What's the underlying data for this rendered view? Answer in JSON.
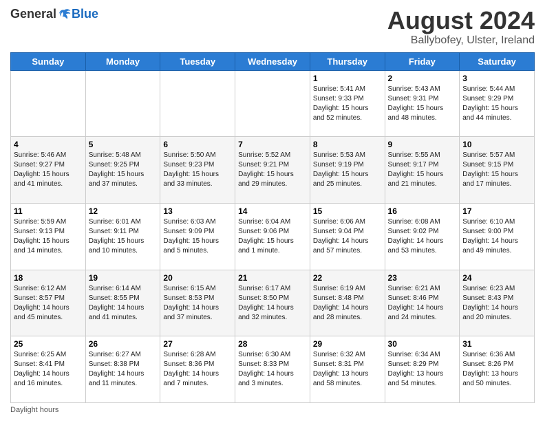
{
  "logo": {
    "general": "General",
    "blue": "Blue"
  },
  "title": {
    "month_year": "August 2024",
    "location": "Ballybofey, Ulster, Ireland"
  },
  "days_of_week": [
    "Sunday",
    "Monday",
    "Tuesday",
    "Wednesday",
    "Thursday",
    "Friday",
    "Saturday"
  ],
  "footer": {
    "daylight_label": "Daylight hours"
  },
  "weeks": [
    [
      {
        "date": "",
        "info": ""
      },
      {
        "date": "",
        "info": ""
      },
      {
        "date": "",
        "info": ""
      },
      {
        "date": "",
        "info": ""
      },
      {
        "date": "1",
        "info": "Sunrise: 5:41 AM\nSunset: 9:33 PM\nDaylight: 15 hours\nand 52 minutes."
      },
      {
        "date": "2",
        "info": "Sunrise: 5:43 AM\nSunset: 9:31 PM\nDaylight: 15 hours\nand 48 minutes."
      },
      {
        "date": "3",
        "info": "Sunrise: 5:44 AM\nSunset: 9:29 PM\nDaylight: 15 hours\nand 44 minutes."
      }
    ],
    [
      {
        "date": "4",
        "info": "Sunrise: 5:46 AM\nSunset: 9:27 PM\nDaylight: 15 hours\nand 41 minutes."
      },
      {
        "date": "5",
        "info": "Sunrise: 5:48 AM\nSunset: 9:25 PM\nDaylight: 15 hours\nand 37 minutes."
      },
      {
        "date": "6",
        "info": "Sunrise: 5:50 AM\nSunset: 9:23 PM\nDaylight: 15 hours\nand 33 minutes."
      },
      {
        "date": "7",
        "info": "Sunrise: 5:52 AM\nSunset: 9:21 PM\nDaylight: 15 hours\nand 29 minutes."
      },
      {
        "date": "8",
        "info": "Sunrise: 5:53 AM\nSunset: 9:19 PM\nDaylight: 15 hours\nand 25 minutes."
      },
      {
        "date": "9",
        "info": "Sunrise: 5:55 AM\nSunset: 9:17 PM\nDaylight: 15 hours\nand 21 minutes."
      },
      {
        "date": "10",
        "info": "Sunrise: 5:57 AM\nSunset: 9:15 PM\nDaylight: 15 hours\nand 17 minutes."
      }
    ],
    [
      {
        "date": "11",
        "info": "Sunrise: 5:59 AM\nSunset: 9:13 PM\nDaylight: 15 hours\nand 14 minutes."
      },
      {
        "date": "12",
        "info": "Sunrise: 6:01 AM\nSunset: 9:11 PM\nDaylight: 15 hours\nand 10 minutes."
      },
      {
        "date": "13",
        "info": "Sunrise: 6:03 AM\nSunset: 9:09 PM\nDaylight: 15 hours\nand 5 minutes."
      },
      {
        "date": "14",
        "info": "Sunrise: 6:04 AM\nSunset: 9:06 PM\nDaylight: 15 hours\nand 1 minute."
      },
      {
        "date": "15",
        "info": "Sunrise: 6:06 AM\nSunset: 9:04 PM\nDaylight: 14 hours\nand 57 minutes."
      },
      {
        "date": "16",
        "info": "Sunrise: 6:08 AM\nSunset: 9:02 PM\nDaylight: 14 hours\nand 53 minutes."
      },
      {
        "date": "17",
        "info": "Sunrise: 6:10 AM\nSunset: 9:00 PM\nDaylight: 14 hours\nand 49 minutes."
      }
    ],
    [
      {
        "date": "18",
        "info": "Sunrise: 6:12 AM\nSunset: 8:57 PM\nDaylight: 14 hours\nand 45 minutes."
      },
      {
        "date": "19",
        "info": "Sunrise: 6:14 AM\nSunset: 8:55 PM\nDaylight: 14 hours\nand 41 minutes."
      },
      {
        "date": "20",
        "info": "Sunrise: 6:15 AM\nSunset: 8:53 PM\nDaylight: 14 hours\nand 37 minutes."
      },
      {
        "date": "21",
        "info": "Sunrise: 6:17 AM\nSunset: 8:50 PM\nDaylight: 14 hours\nand 32 minutes."
      },
      {
        "date": "22",
        "info": "Sunrise: 6:19 AM\nSunset: 8:48 PM\nDaylight: 14 hours\nand 28 minutes."
      },
      {
        "date": "23",
        "info": "Sunrise: 6:21 AM\nSunset: 8:46 PM\nDaylight: 14 hours\nand 24 minutes."
      },
      {
        "date": "24",
        "info": "Sunrise: 6:23 AM\nSunset: 8:43 PM\nDaylight: 14 hours\nand 20 minutes."
      }
    ],
    [
      {
        "date": "25",
        "info": "Sunrise: 6:25 AM\nSunset: 8:41 PM\nDaylight: 14 hours\nand 16 minutes."
      },
      {
        "date": "26",
        "info": "Sunrise: 6:27 AM\nSunset: 8:38 PM\nDaylight: 14 hours\nand 11 minutes."
      },
      {
        "date": "27",
        "info": "Sunrise: 6:28 AM\nSunset: 8:36 PM\nDaylight: 14 hours\nand 7 minutes."
      },
      {
        "date": "28",
        "info": "Sunrise: 6:30 AM\nSunset: 8:33 PM\nDaylight: 14 hours\nand 3 minutes."
      },
      {
        "date": "29",
        "info": "Sunrise: 6:32 AM\nSunset: 8:31 PM\nDaylight: 13 hours\nand 58 minutes."
      },
      {
        "date": "30",
        "info": "Sunrise: 6:34 AM\nSunset: 8:29 PM\nDaylight: 13 hours\nand 54 minutes."
      },
      {
        "date": "31",
        "info": "Sunrise: 6:36 AM\nSunset: 8:26 PM\nDaylight: 13 hours\nand 50 minutes."
      }
    ]
  ]
}
